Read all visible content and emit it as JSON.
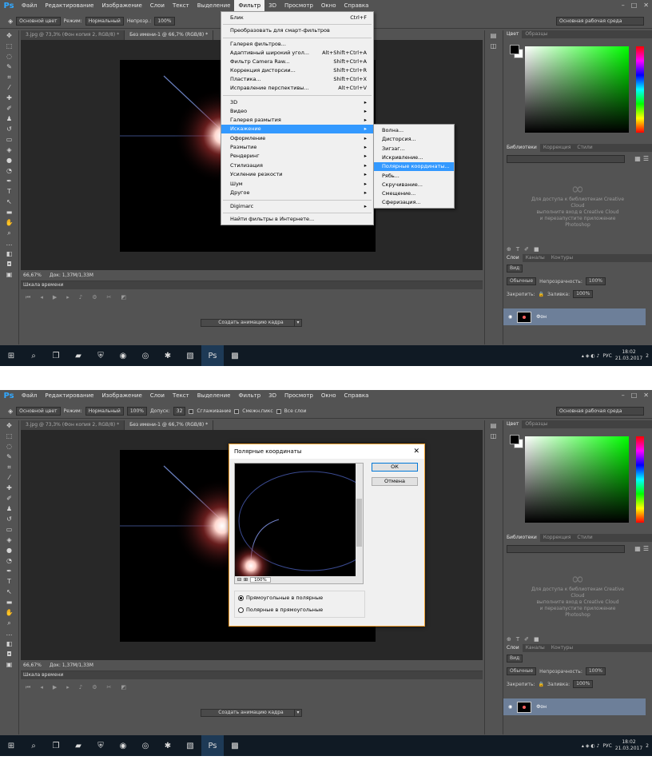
{
  "menubar": {
    "logo": "Ps",
    "items": [
      "Файл",
      "Редактирование",
      "Изображение",
      "Слои",
      "Текст",
      "Выделение",
      "Фильтр",
      "3D",
      "Просмотр",
      "Окно",
      "Справка"
    ],
    "active_index": 6
  },
  "options_bar": {
    "mode1": "Основной цвет",
    "mode_label": "Режим:",
    "mode_value": "Нормальный",
    "opacity_label": "Непрозр.:",
    "opacity_value": "100%",
    "tolerance_label": "Допуск:",
    "tolerance_value": "32",
    "smoothing_label": "Сглаживание",
    "contiguous_label": "Смежн.пикс",
    "all_layers_label": "Все слои",
    "workspace": "Основная рабочая среда"
  },
  "doc_tabs": [
    "3.jpg @ 73,3% (Фон копия 2, RGB/8) *",
    "Без имени-1 @ 66,7% (RGB/8) *"
  ],
  "status": {
    "zoom": "66,67%",
    "doc_size": "Док: 1,37M/1,33M"
  },
  "timeline": {
    "title": "Шкала времени",
    "create_button": "Создать анимацию кадра"
  },
  "panels": {
    "color_tabs": [
      "Цвет",
      "Образцы"
    ],
    "library_tabs": [
      "Библиотеки",
      "Коррекция",
      "Стили"
    ],
    "library_message": [
      "Для доступа к библиотекам Creative",
      "Cloud",
      "выполните вход в Creative Cloud",
      "и перезапустите приложение",
      "Photoshop"
    ],
    "layers_tabs": [
      "Слои",
      "Каналы",
      "Контуры"
    ],
    "kind": "Вид",
    "blend": "Обычные",
    "opacity_label": "Непрозрачность:",
    "opacity_value": "100%",
    "lock_label": "Закрепить:",
    "fill_label": "Заливка:",
    "fill_value": "100%",
    "layer_name": "Фон"
  },
  "taskbar": {
    "lang": "РУС",
    "time": "18:02",
    "date": "21.03.2017",
    "notif": "2"
  },
  "filter_menu": {
    "items": [
      {
        "label": "Блик",
        "shortcut": "Ctrl+F"
      },
      {
        "label": "Преобразовать для смарт-фильтров",
        "shortcut": ""
      },
      {
        "label": "Галерея фильтров...",
        "shortcut": ""
      },
      {
        "label": "Адаптивный широкий угол...",
        "shortcut": "Alt+Shift+Ctrl+A"
      },
      {
        "label": "Фильтр Camera Raw...",
        "shortcut": "Shift+Ctrl+A"
      },
      {
        "label": "Коррекция дисторсии...",
        "shortcut": "Shift+Ctrl+R"
      },
      {
        "label": "Пластика...",
        "shortcut": "Shift+Ctrl+X"
      },
      {
        "label": "Исправление перспективы...",
        "shortcut": "Alt+Ctrl+V"
      },
      {
        "label": "3D",
        "shortcut": "▸"
      },
      {
        "label": "Видео",
        "shortcut": "▸"
      },
      {
        "label": "Галерея размытия",
        "shortcut": "▸"
      },
      {
        "label": "Искажение",
        "shortcut": "▸"
      },
      {
        "label": "Оформление",
        "shortcut": "▸"
      },
      {
        "label": "Размытие",
        "shortcut": "▸"
      },
      {
        "label": "Рендеринг",
        "shortcut": "▸"
      },
      {
        "label": "Стилизация",
        "shortcut": "▸"
      },
      {
        "label": "Усиление резкости",
        "shortcut": "▸"
      },
      {
        "label": "Шум",
        "shortcut": "▸"
      },
      {
        "label": "Другое",
        "shortcut": "▸"
      },
      {
        "label": "Digimarc",
        "shortcut": "▸"
      },
      {
        "label": "Найти фильтры в Интернете...",
        "shortcut": ""
      }
    ],
    "highlighted": "Искажение"
  },
  "distort_submenu": {
    "items": [
      "Волна...",
      "Дисторсия...",
      "Зигзаг...",
      "Искривление...",
      "Полярные координаты...",
      "Рябь...",
      "Скручивание...",
      "Смещение...",
      "Сферизация..."
    ],
    "highlighted": "Полярные координаты..."
  },
  "dialog": {
    "title": "Полярные координаты",
    "close": "✕",
    "ok": "ОК",
    "cancel": "Отмена",
    "zoom": "100%",
    "radio1": "Прямоугольные в полярные",
    "radio2": "Полярные в прямоугольные",
    "selected_option": 1
  }
}
